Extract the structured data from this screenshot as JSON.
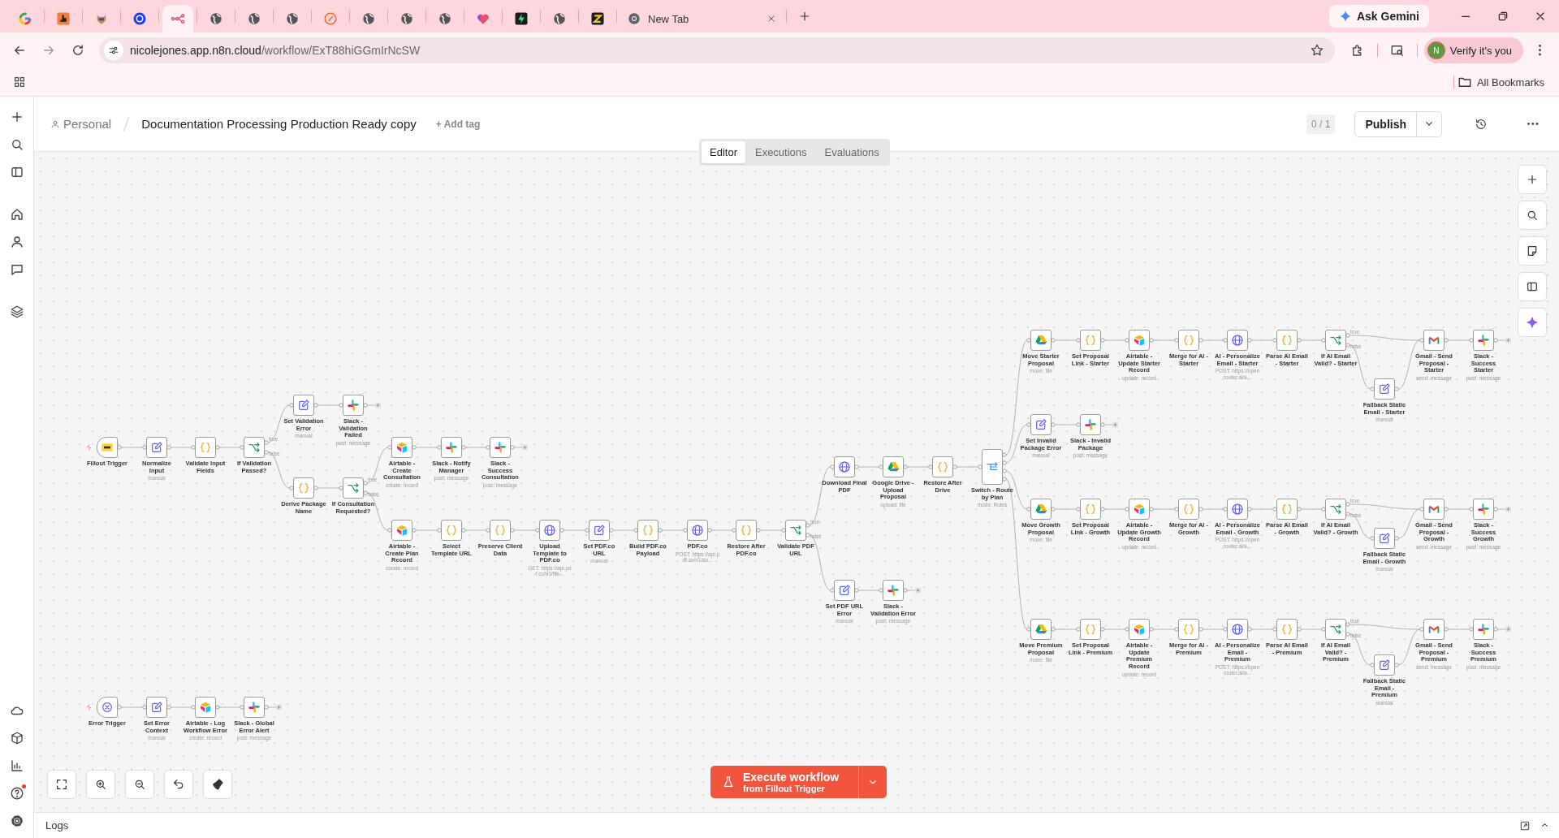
{
  "browser": {
    "tabs": [
      {
        "kind": "google",
        "selected": false
      },
      {
        "kind": "orange",
        "selected": false
      },
      {
        "kind": "mascot",
        "selected": false
      },
      {
        "kind": "blue",
        "selected": false
      },
      {
        "kind": "n8n",
        "selected": true
      },
      {
        "kind": "globe",
        "selected": false
      },
      {
        "kind": "globe",
        "selected": false
      },
      {
        "kind": "globe",
        "selected": false
      },
      {
        "kind": "clock",
        "selected": false
      },
      {
        "kind": "globe",
        "selected": false
      },
      {
        "kind": "globe",
        "selected": false
      },
      {
        "kind": "globe",
        "selected": false
      },
      {
        "kind": "heart",
        "selected": false
      },
      {
        "kind": "bolt",
        "selected": false
      },
      {
        "kind": "globe",
        "selected": false
      },
      {
        "kind": "zed",
        "selected": false
      },
      {
        "kind": "chrome",
        "title": "New Tab",
        "selected": false
      }
    ],
    "gemini": "Ask Gemini",
    "url_host": "nicolejones.app.n8n.cloud",
    "url_path": "/workflow/ExT88hiGGmIrNcSW",
    "profile_initial": "N",
    "profile_label": "Verify it's you",
    "bookmarks": "All Bookmarks"
  },
  "sidebar": {
    "help_alert": true
  },
  "header": {
    "breadcrumb": "Personal",
    "title": "Documentation Processing Production Ready copy",
    "add_tag": "+ Add tag",
    "counter": "0 / 1",
    "publish": "Publish",
    "tabs": [
      {
        "label": "Editor",
        "selected": true
      },
      {
        "label": "Executions",
        "selected": false
      },
      {
        "label": "Evaluations",
        "selected": false
      }
    ]
  },
  "canvas": {
    "nodes": [
      {
        "label": "Fillout Trigger",
        "kind": "trigger",
        "open_end": false
      },
      {
        "label": "Normalize Input",
        "subtitle": "manual",
        "kind": "set",
        "open_end": false
      },
      {
        "label": "Validate Input Fields",
        "kind": "code",
        "open_end": false
      },
      {
        "label": "If Validation Passed?",
        "kind": "if",
        "outputs": [
          "true",
          "false"
        ],
        "open_end": false
      },
      {
        "label": "Set Validation Error",
        "subtitle": "manual",
        "kind": "set",
        "open_end": false
      },
      {
        "label": "Slack - Validation Failed",
        "subtitle": "post: message",
        "kind": "slack",
        "open_end": true
      },
      {
        "label": "Derive Package Name",
        "kind": "code",
        "open_end": false
      },
      {
        "label": "If Consultation Requested?",
        "kind": "if",
        "outputs": [
          "true",
          "false"
        ],
        "open_end": false
      },
      {
        "label": "Airtable - Create Consultation",
        "subtitle": "create: record",
        "kind": "airtable",
        "open_end": false
      },
      {
        "label": "Slack - Notify Manager",
        "subtitle": "post: message",
        "kind": "slack",
        "open_end": false
      },
      {
        "label": "Slack - Success Consultation",
        "subtitle": "post: message",
        "kind": "slack",
        "open_end": true
      },
      {
        "label": "Airtable - Create Plan Record",
        "subtitle": "create: record",
        "kind": "airtable",
        "open_end": false
      },
      {
        "label": "Select Template URL",
        "kind": "code",
        "open_end": false
      },
      {
        "label": "Preserve Client Data",
        "kind": "code",
        "open_end": false
      },
      {
        "label": "Upload Template to PDF.co",
        "subtitle": "GET: https://api.pdf.co/v1/file...",
        "kind": "http",
        "open_end": false
      },
      {
        "label": "Set PDF.co URL",
        "subtitle": "manual",
        "kind": "set",
        "open_end": false
      },
      {
        "label": "Build PDF.co Payload",
        "kind": "code",
        "open_end": false
      },
      {
        "label": "PDF.co",
        "subtitle": "POST: https://api.pdf.co/v1/do...",
        "kind": "http",
        "open_end": false
      },
      {
        "label": "Restore After PDF.co",
        "kind": "code",
        "open_end": false
      },
      {
        "label": "Validate PDF URL",
        "kind": "if",
        "outputs": [
          "true",
          "false"
        ],
        "open_end": false
      },
      {
        "label": "Download Final PDF",
        "kind": "http",
        "open_end": false
      },
      {
        "label": "Google Drive - Upload Proposal",
        "subtitle": "upload: file",
        "kind": "drive",
        "open_end": false
      },
      {
        "label": "Restore After Drive",
        "kind": "code",
        "open_end": false
      },
      {
        "label": "Switch - Route by Plan",
        "subtitle": "mode: Rules",
        "kind": "switch",
        "open_end": false
      },
      {
        "label": "Set PDF URL Error",
        "subtitle": "manual",
        "kind": "set",
        "open_end": false
      },
      {
        "label": "Slack - Validation Error",
        "subtitle": "post: message",
        "kind": "slack",
        "open_end": true
      },
      {
        "label": "Move Starter Proposal",
        "subtitle": "move: file",
        "kind": "drive",
        "open_end": false
      },
      {
        "label": "Set Proposal Link - Starter",
        "kind": "code",
        "open_end": false
      },
      {
        "label": "Airtable - Update Starter Record",
        "subtitle": "update: record",
        "kind": "airtable",
        "open_end": false
      },
      {
        "label": "Merge for AI - Starter",
        "kind": "code",
        "open_end": false
      },
      {
        "label": "AI - Personalize Email - Starter",
        "subtitle": "POST: https://openrouter.ai/a...",
        "kind": "http",
        "open_end": false
      },
      {
        "label": "Parse AI Email - Starter",
        "kind": "code",
        "open_end": false
      },
      {
        "label": "If AI Email Valid? - Starter",
        "kind": "if",
        "outputs": [
          "true",
          "false"
        ],
        "open_end": false
      },
      {
        "label": "Fallback Static Email - Starter",
        "subtitle": "manual",
        "kind": "set",
        "open_end": false
      },
      {
        "label": "Gmail - Send Proposal - Starter",
        "subtitle": "send: message",
        "kind": "gmail",
        "open_end": false
      },
      {
        "label": "Slack - Success Starter",
        "subtitle": "post: message",
        "kind": "slack",
        "open_end": true
      },
      {
        "label": "Set Invalid Package Error",
        "subtitle": "manual",
        "kind": "set",
        "open_end": false
      },
      {
        "label": "Slack - Invalid Package",
        "subtitle": "post: message",
        "kind": "slack",
        "open_end": true
      },
      {
        "label": "Move Growth Proposal",
        "subtitle": "move: file",
        "kind": "drive",
        "open_end": false
      },
      {
        "label": "Set Proposal Link - Growth",
        "kind": "code",
        "open_end": false
      },
      {
        "label": "Airtable - Update Growth Record",
        "subtitle": "update: record",
        "kind": "airtable",
        "open_end": false
      },
      {
        "label": "Merge for AI - Growth",
        "kind": "code",
        "open_end": false
      },
      {
        "label": "AI - Personalize Email - Growth",
        "subtitle": "POST: https://openrouter.ai/a...",
        "kind": "http",
        "open_end": false
      },
      {
        "label": "Parse AI Email - Growth",
        "kind": "code",
        "open_end": false
      },
      {
        "label": "If AI Email Valid? - Growth",
        "kind": "if",
        "outputs": [
          "true",
          "false"
        ],
        "open_end": false
      },
      {
        "label": "Fallback Static Email - Growth",
        "subtitle": "manual",
        "kind": "set",
        "open_end": false
      },
      {
        "label": "Gmail - Send Proposal - Growth",
        "subtitle": "send: message",
        "kind": "gmail",
        "open_end": false
      },
      {
        "label": "Slack - Success Growth",
        "subtitle": "post: message",
        "kind": "slack",
        "open_end": true
      },
      {
        "label": "Move Premium Proposal",
        "subtitle": "move: file",
        "kind": "drive",
        "open_end": false
      },
      {
        "label": "Set Proposal Link - Premium",
        "kind": "code",
        "open_end": false
      },
      {
        "label": "Airtable - Update Premium Record",
        "subtitle": "update: record",
        "kind": "airtable",
        "open_end": false
      },
      {
        "label": "Merge for AI - Premium",
        "kind": "code",
        "open_end": false
      },
      {
        "label": "AI - Personalize Email - Premium",
        "subtitle": "POST: https://openrouter.ai/a...",
        "kind": "http",
        "open_end": false
      },
      {
        "label": "Parse AI Email - Premium",
        "kind": "code",
        "open_end": false
      },
      {
        "label": "If AI Email Valid? - Premium",
        "kind": "if",
        "outputs": [
          "true",
          "false"
        ],
        "open_end": false
      },
      {
        "label": "Fallback Static Email - Premium",
        "subtitle": "manual",
        "kind": "set",
        "open_end": false
      },
      {
        "label": "Gmail - Send Proposal - Premium",
        "subtitle": "send: message",
        "kind": "gmail",
        "open_end": false
      },
      {
        "label": "Slack - Success Premium",
        "subtitle": "post: message",
        "kind": "slack",
        "open_end": true
      },
      {
        "label": "Error Trigger",
        "kind": "error_trigger",
        "open_end": false
      },
      {
        "label": "Set Error Context",
        "subtitle": "manual",
        "kind": "set",
        "open_end": false
      },
      {
        "label": "Airtable - Log Workflow Error",
        "subtitle": "create: record",
        "kind": "airtable",
        "open_end": false
      },
      {
        "label": "Slack - Global Error Alert",
        "subtitle": "post: message",
        "kind": "slack",
        "open_end": true
      }
    ]
  },
  "execute": {
    "label": "Execute workflow",
    "sublabel": "from Fillout Trigger"
  },
  "logs": {
    "label": "Logs"
  }
}
